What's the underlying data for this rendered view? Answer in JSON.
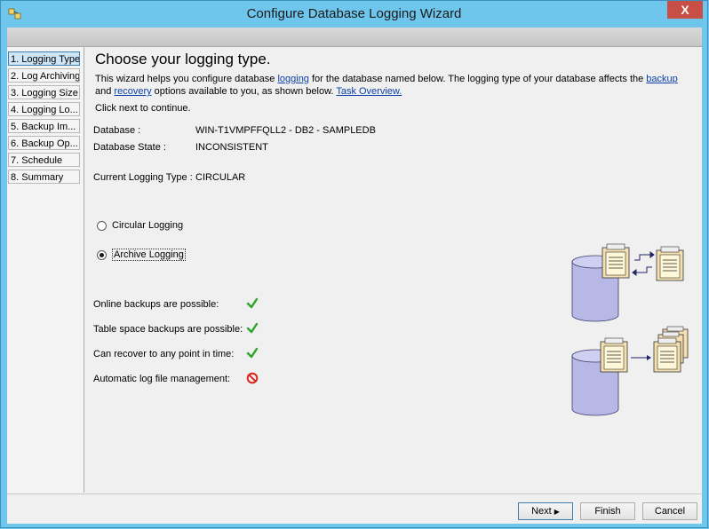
{
  "window": {
    "title": "Configure Database Logging Wizard",
    "close_glyph": "X"
  },
  "nav": {
    "items": [
      {
        "label": "1. Logging Type"
      },
      {
        "label": "2. Log Archiving"
      },
      {
        "label": "3. Logging Size"
      },
      {
        "label": "4. Logging Lo..."
      },
      {
        "label": "5. Backup Im..."
      },
      {
        "label": "6. Backup Op..."
      },
      {
        "label": "7. Schedule"
      },
      {
        "label": "8. Summary"
      }
    ]
  },
  "main": {
    "title": "Choose your logging type.",
    "desc_1": "This wizard helps you configure database ",
    "desc_link_logging": "logging",
    "desc_2": " for the database named below.  The logging type of your database affects the ",
    "desc_link_backup": "backup",
    "desc_3": "and ",
    "desc_link_recovery": "recovery",
    "desc_4": " options available to you, as shown below. ",
    "desc_link_task": "Task Overview.",
    "click_next": "Click next to continue.",
    "database_label": "Database :",
    "database_value": "WIN-T1VMPFFQLL2 - DB2 - SAMPLEDB",
    "state_label": "Database State :",
    "state_value": "INCONSISTENT",
    "current_label": "Current Logging Type :",
    "current_value": "CIRCULAR",
    "radio_circular": "Circular Logging",
    "radio_archive": "Archive Logging",
    "features": [
      {
        "label": "Online backups are possible:",
        "status": "yes"
      },
      {
        "label": "Table space backups are possible:",
        "status": "yes"
      },
      {
        "label": "Can recover to any point in time:",
        "status": "yes"
      },
      {
        "label": "Automatic log file management:",
        "status": "no"
      }
    ]
  },
  "buttons": {
    "next": "Next",
    "finish": "Finish",
    "cancel": "Cancel"
  },
  "colors": {
    "check": "#2aa52a",
    "no": "#d9271f",
    "cylinder": "#b8b8e6",
    "link": "#0b3fa8"
  }
}
